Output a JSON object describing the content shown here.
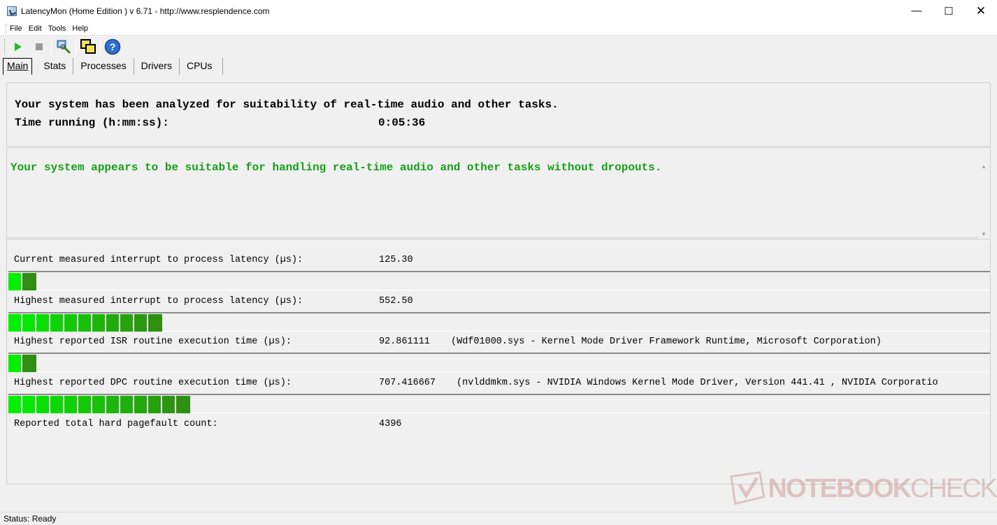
{
  "window": {
    "title": "LatencyMon  (Home Edition )  v 6.71 - http://www.resplendence.com",
    "minimize": "—",
    "maximize": "☐",
    "close": "✕"
  },
  "menu": {
    "items": [
      {
        "label": "File"
      },
      {
        "label": "Edit"
      },
      {
        "label": "Tools"
      },
      {
        "label": "Help"
      }
    ]
  },
  "toolbar": {
    "buttons": [
      {
        "icon": "play-icon"
      },
      {
        "icon": "stop-icon"
      },
      {
        "icon": "probe-icon"
      },
      {
        "icon": "windows-icon"
      },
      {
        "icon": "help-icon"
      }
    ]
  },
  "tabs": [
    {
      "label": "Main",
      "active": true
    },
    {
      "label": "Stats"
    },
    {
      "label": "Processes"
    },
    {
      "label": "Drivers"
    },
    {
      "label": "CPUs"
    }
  ],
  "summary": {
    "analyzed_text": "Your system has been analyzed for suitability of real-time audio and other tasks.",
    "time_label": "Time running (h:mm:ss):",
    "time_value": "0:05:36"
  },
  "verdict": {
    "text": "Your system appears to be suitable for handling real-time audio and other tasks without dropouts.",
    "color": "#16a016"
  },
  "metrics": [
    {
      "label": "Current measured interrupt to process latency (µs):",
      "value": "125.30",
      "detail": "",
      "bar_segments": 2
    },
    {
      "label": "Highest measured interrupt to process latency (µs):",
      "value": "552.50",
      "detail": "",
      "bar_segments": 11
    },
    {
      "label": "Highest reported ISR routine execution time (µs):",
      "value": "92.861111",
      "detail": "(Wdf01000.sys - Kernel Mode Driver Framework Runtime, Microsoft Corporation)",
      "bar_segments": 2
    },
    {
      "label": "Highest reported DPC routine execution time (µs):",
      "value": "707.416667",
      "detail": "(nvlddmkm.sys - NVIDIA Windows Kernel Mode Driver, Version 441.41 , NVIDIA Corporatio",
      "bar_segments": 13
    },
    {
      "label": "Reported total hard pagefault count:",
      "value": "4396",
      "detail": ""
    }
  ],
  "status": {
    "text": "Status: Ready"
  },
  "watermark": {
    "text_bold": "NOTEBOOK",
    "text_thin": "CHECK"
  },
  "colors": {
    "bar_bright": "#00f000",
    "bar_dark": "#2f8f12"
  }
}
